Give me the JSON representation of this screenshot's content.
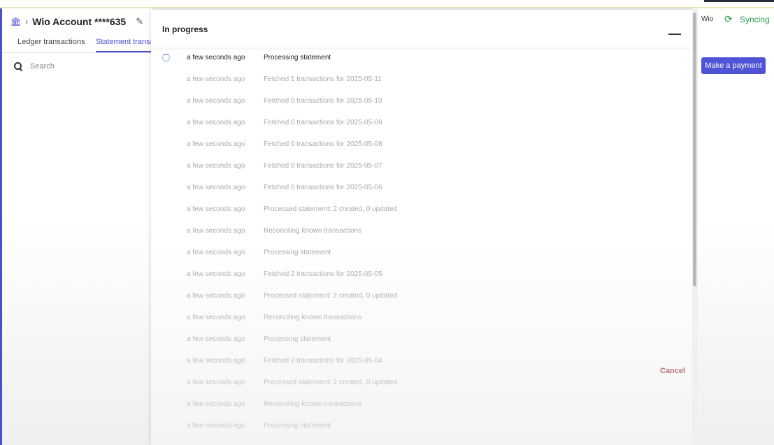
{
  "breadcrumb": {
    "account_title": "Wio Account ****635"
  },
  "tabs": [
    {
      "label": "Ledger transactions"
    },
    {
      "label": "Statement transa"
    }
  ],
  "search": {
    "placeholder": "Search"
  },
  "topbar": {
    "org_label": "Wio",
    "sync_status": "Syncing"
  },
  "actions": {
    "make_payment": "Make a payment",
    "cancel": "Cancel"
  },
  "modal": {
    "title": "In progress",
    "entries": [
      {
        "time": "a few seconds ago",
        "message": "Processing statement",
        "active": true
      },
      {
        "time": "a few seconds ago",
        "message": "Fetched 1 transactions for 2025-05-11"
      },
      {
        "time": "a few seconds ago",
        "message": "Fetched 0 transactions for 2025-05-10"
      },
      {
        "time": "a few seconds ago",
        "message": "Fetched 0 transactions for 2025-05-09"
      },
      {
        "time": "a few seconds ago",
        "message": "Fetched 0 transactions for 2025-05-08"
      },
      {
        "time": "a few seconds ago",
        "message": "Fetched 0 transactions for 2025-05-07"
      },
      {
        "time": "a few seconds ago",
        "message": "Fetched 0 transactions for 2025-05-06"
      },
      {
        "time": "a few seconds ago",
        "message": "Processed statement: 2 created, 0 updated"
      },
      {
        "time": "a few seconds ago",
        "message": "Reconciling known transactions"
      },
      {
        "time": "a few seconds ago",
        "message": "Processing statement"
      },
      {
        "time": "a few seconds ago",
        "message": "Fetched 2 transactions for 2025-05-05"
      },
      {
        "time": "a few seconds ago",
        "message": "Processed statement: 2 created, 0 updated"
      },
      {
        "time": "a few seconds ago",
        "message": "Reconciling known transactions"
      },
      {
        "time": "a few seconds ago",
        "message": "Processing statement"
      },
      {
        "time": "a few seconds ago",
        "message": "Fetched 2 transactions for 2025-05-04"
      },
      {
        "time": "a few seconds ago",
        "message": "Processed statement: 2 created, 0 updated"
      },
      {
        "time": "a few seconds ago",
        "message": "Reconciling known transactions"
      },
      {
        "time": "a few seconds ago",
        "message": "Processing statement"
      }
    ]
  },
  "colors": {
    "accent": "#4f53d6",
    "sync_green": "#2f9a4a",
    "cancel_red": "#a22a3a"
  }
}
